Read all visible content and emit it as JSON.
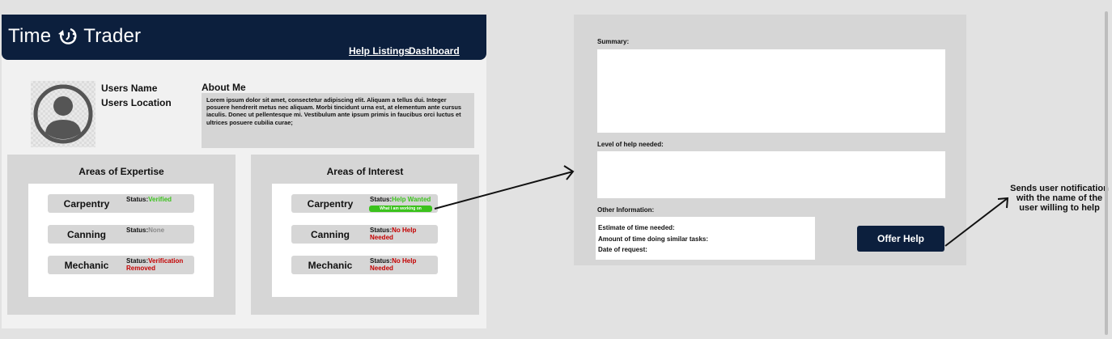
{
  "app": {
    "brand_left": "Time",
    "brand_right": "Trader",
    "brand_icon": "clock-arrow-icon",
    "nav": [
      "Help Listings",
      "Dashboard"
    ]
  },
  "profile": {
    "name": "Users Name",
    "location": "Users Location",
    "avatar_icon": "user-avatar-icon",
    "about_title": "About Me",
    "about_text": "Lorem ipsum dolor sit amet, consectetur adipiscing elit. Aliquam a tellus dui. Integer posuere hendrerit metus nec aliquam. Morbi tincidunt urna est, at elementum ante cursus iaculis. Donec ut pellentesque mi. Vestibulum ante ipsum primis in faucibus orci luctus et ultrices posuere cubilia curae;"
  },
  "expertise": {
    "title": "Areas of Expertise",
    "items": [
      {
        "name": "Carpentry",
        "status_label": "Status:",
        "status": "Verified",
        "status_color": "#3cc21d"
      },
      {
        "name": "Canning",
        "status_label": "Status:",
        "status": "None",
        "status_color": "#8a8a8a"
      },
      {
        "name": "Mechanic",
        "status_label": "Status:",
        "status": "Verification Removed",
        "status_color": "#c40000"
      }
    ]
  },
  "interest": {
    "title": "Areas of Interest",
    "items": [
      {
        "name": "Carpentry",
        "status_label": "Status:",
        "status": "Help Wanted",
        "status_color": "#3cc21d",
        "badge": "What I am working on"
      },
      {
        "name": "Canning",
        "status_label": "Status:",
        "status": "No Help Needed",
        "status_color": "#c40000"
      },
      {
        "name": "Mechanic",
        "status_label": "Status:",
        "status": "No Help Needed",
        "status_color": "#c40000"
      }
    ]
  },
  "offer_form": {
    "summary_label": "Summary:",
    "level_label": "Level of help needed:",
    "other_label": "Other Information:",
    "info_lines": [
      "Estimate of time needed:",
      "Amount of time doing similar tasks:",
      "Date of request:"
    ],
    "button_label": "Offer Help"
  },
  "annotation": {
    "note": "Sends user notification with the name of the user willing to help"
  },
  "colors": {
    "navy": "#0c1f3d",
    "panel_grey": "#d6d6d6",
    "status_green": "#3cc21d",
    "status_red": "#c40000"
  }
}
